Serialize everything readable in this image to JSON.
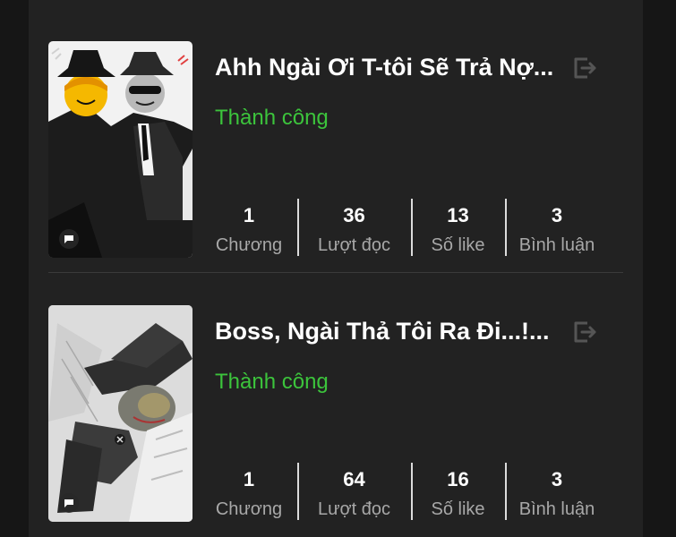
{
  "stories": [
    {
      "title": "Ahh Ngài Ơi T-tôi Sẽ Trả Nợ...",
      "status": "Thành công",
      "stats": [
        {
          "value": "1",
          "label": "Chương"
        },
        {
          "value": "36",
          "label": "Lượt đọc"
        },
        {
          "value": "13",
          "label": "Số like"
        },
        {
          "value": "3",
          "label": "Bình luận"
        }
      ]
    },
    {
      "title": "Boss, Ngài Thả Tôi Ra Đi...!...",
      "status": "Thành công",
      "stats": [
        {
          "value": "1",
          "label": "Chương"
        },
        {
          "value": "64",
          "label": "Lượt đọc"
        },
        {
          "value": "16",
          "label": "Số like"
        },
        {
          "value": "3",
          "label": "Bình luận"
        }
      ]
    }
  ],
  "colors": {
    "background": "#161616",
    "panel": "#222222",
    "status_success": "#3cc43c",
    "title": "#ffffff",
    "label": "#a8a8a8"
  },
  "icons": {
    "export": "export-icon",
    "chat": "chat-bubble-icon"
  }
}
